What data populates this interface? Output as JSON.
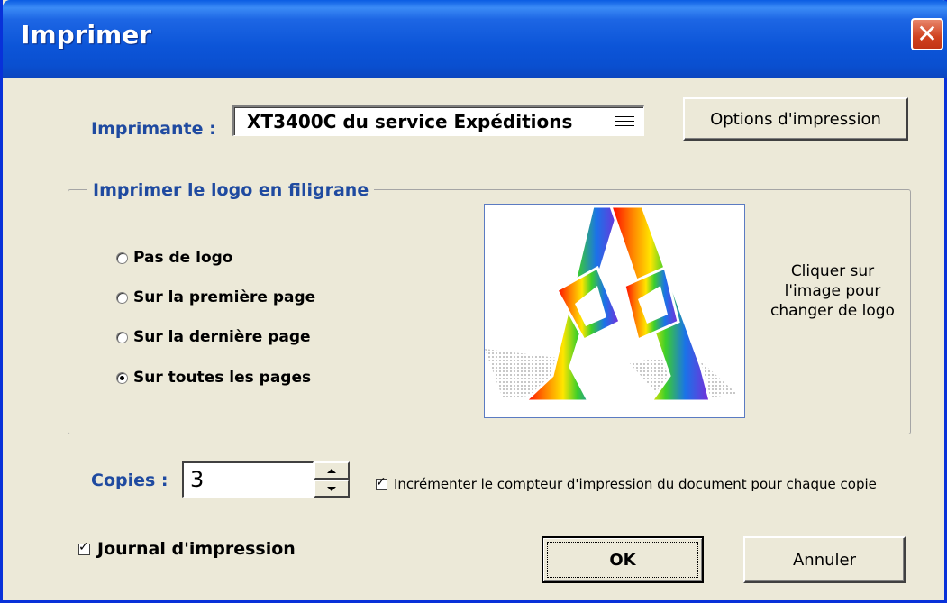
{
  "window": {
    "title": "Imprimer"
  },
  "printer": {
    "label": "Imprimante :",
    "selected": "XT3400C du service Expéditions",
    "options_button": "Options d'impression"
  },
  "logo_group": {
    "title": "Imprimer le logo en  filigrane",
    "options": [
      {
        "label": "Pas de logo",
        "selected": false
      },
      {
        "label": "Sur la première page",
        "selected": false
      },
      {
        "label": "Sur la dernière page",
        "selected": false
      },
      {
        "label": "Sur toutes les pages",
        "selected": true
      }
    ],
    "hint": "Cliquer sur l'image pour changer de logo"
  },
  "copies": {
    "label": "Copies :",
    "value": "3",
    "increment_label": "Incrémenter le compteur d'impression du document pour chaque copie",
    "increment_checked": true
  },
  "journal": {
    "label": "Journal d'impression",
    "checked": true
  },
  "buttons": {
    "ok": "OK",
    "cancel": "Annuler"
  },
  "icons": {
    "close": "close-icon",
    "spin_up": "chevron-up-icon",
    "spin_down": "chevron-down-icon",
    "combo": "spin-icon"
  },
  "colors": {
    "titlebar": "#0a5ce3",
    "close": "#d0421f",
    "label_blue": "#1f4aa0",
    "background": "#ece9d8"
  }
}
